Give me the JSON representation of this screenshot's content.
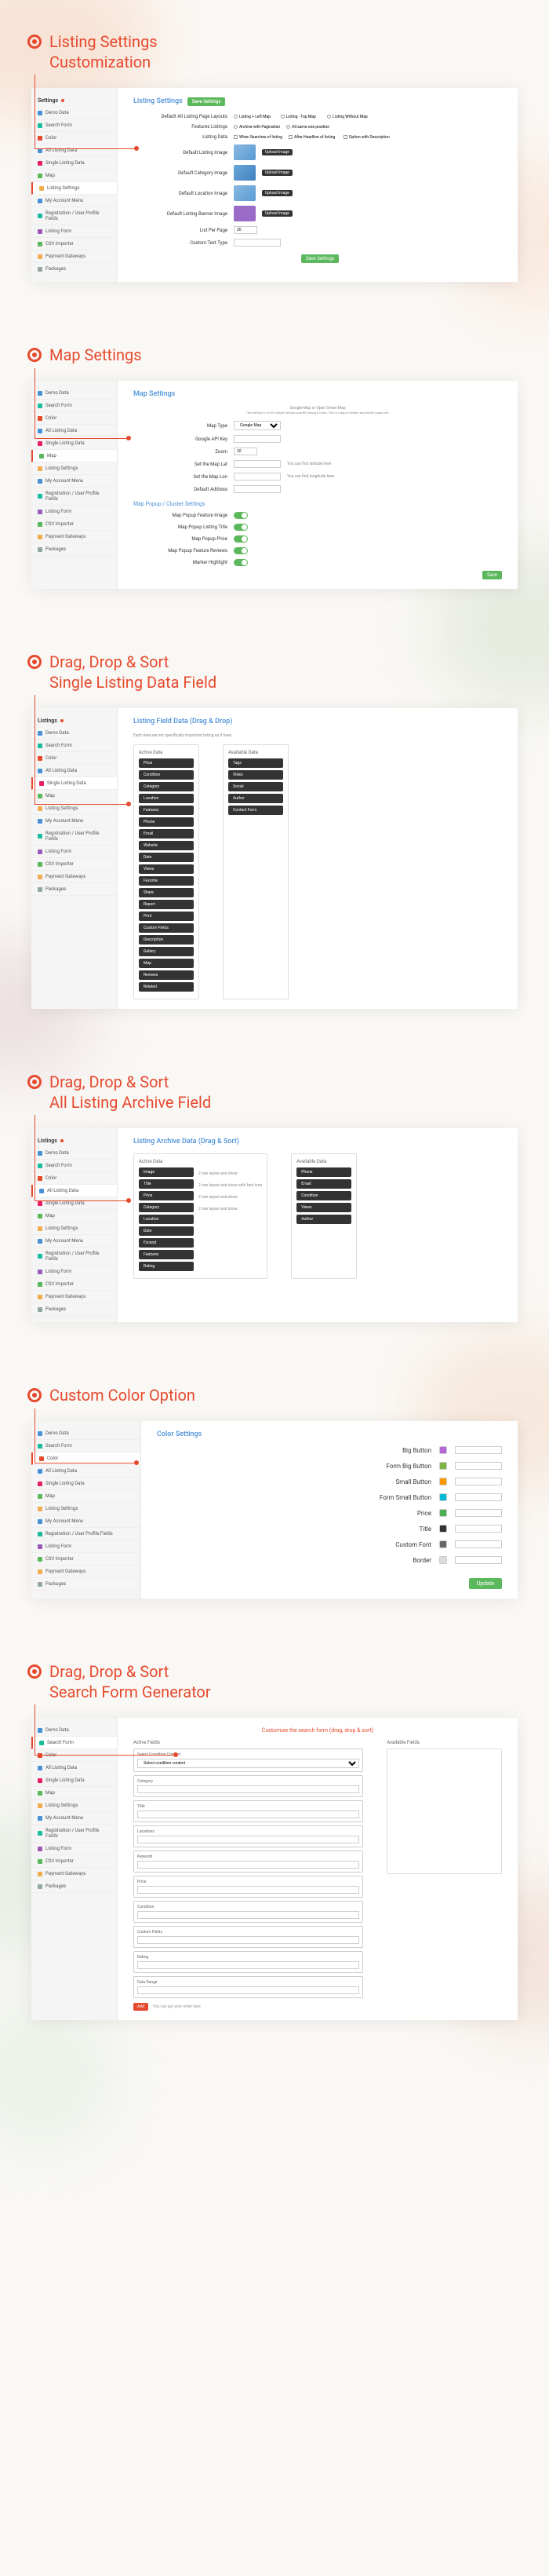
{
  "sections": [
    {
      "title": "Listing Settings\nCustomization"
    },
    {
      "title": "Map Settings"
    },
    {
      "title": "Drag, Drop & Sort\nSingle Listing Data Field"
    },
    {
      "title": "Drag, Drop & Sort\nAll Listing Archive Field"
    },
    {
      "title": "Custom Color Option"
    },
    {
      "title": "Drag, Drop & Sort\nSearch Form Generator"
    }
  ],
  "sidebar1": {
    "title": "Settings",
    "items": [
      "Demo Data",
      "Search Form",
      "Color",
      "All Listing Data",
      "Single Listing Data",
      "Map",
      "Listing Settings",
      "My Account Menu",
      "Registration / User Profile Fields",
      "Listing Form",
      "CSV Importer",
      "Payment Gateways",
      "Packages"
    ]
  },
  "panel1": {
    "title": "Listing Settings",
    "save": "Save Settings",
    "rows": {
      "layouts": "Default All Listing Page Layouts",
      "position": "Features Listings",
      "data": "Listing Data",
      "listing_img": "Default Listing Image",
      "category_img": "Default Category Image",
      "location_img": "Default Location Image",
      "banner_img": "Default Listing Banner Image",
      "per_page": "List Per Page",
      "text_type": "Custom Text Type"
    },
    "radios": [
      "Listing + Left Map",
      "Listing - Top Map",
      "Listing Without Map",
      "Archive with Pagination",
      "All same one position",
      "When Searches of listing",
      "After Headline of listing",
      "Option with Description"
    ],
    "input_val": "20",
    "upload": "Upload Image"
  },
  "sidebar2": {
    "items": [
      "Demo Data",
      "Search Form",
      "Color",
      "All Listing Data",
      "Single Listing Data",
      "Map",
      "Listing Settings",
      "My Account Menu",
      "Registration / User Profile Fields",
      "Listing Form",
      "CSV Importer",
      "Payment Gateways",
      "Packages"
    ]
  },
  "panel2": {
    "title": "Map Settings",
    "note": "Google Map or Open Street Map",
    "note2": "This setting is not for single listings specific listing & more. This is map on header and footer pages etc.",
    "labels": {
      "type": "Map Type",
      "key": "Google API Key",
      "zoom": "Zoom",
      "def_lat": "Set the Map Lat",
      "def_lon": "Set the Map Lon",
      "def_address": "Default Address",
      "section": "Map Popup / Cluster Settings",
      "pop_img": "Map Popup Feature Image",
      "pop_title": "Map Popup Listing Title",
      "pop_price": "Map Popup Price",
      "pop_rating": "Map Popup Feature Reviews",
      "marker": "Marker Highlight"
    },
    "type_opts": [
      "Google Map"
    ],
    "zoom_val": "10",
    "lat_hint": "You can find latitude here",
    "lon_hint": "You can find longitude here",
    "save": "Save"
  },
  "sidebar3": {
    "title": "Listings",
    "items": [
      "Demo Data",
      "Search Form",
      "Color",
      "All Listing Data",
      "Single Listing Data",
      "Map",
      "Listing Settings",
      "My Account Menu",
      "Registration / User Profile Fields",
      "Listing Form",
      "CSV Importer",
      "Payment Gateways",
      "Packages"
    ]
  },
  "panel3": {
    "title": "Listing Field Data (Drag & Drop)",
    "note": "Each data are not specifically important listing as it have",
    "col1": "Active Data",
    "col2": "Available Data",
    "active": [
      "Price",
      "Condition",
      "Category",
      "Location",
      "Features",
      "Phone",
      "Email",
      "Website",
      "Date",
      "Views",
      "Favorite",
      "Share",
      "Report",
      "Print",
      "Custom Fields",
      "Description",
      "Gallery",
      "Map",
      "Reviews",
      "Related"
    ],
    "avail": [
      "Tags",
      "Video",
      "Social",
      "Author",
      "Contact Form"
    ]
  },
  "sidebar4": {
    "title": "Listings",
    "items": [
      "Demo Data",
      "Search Form",
      "Color",
      "All Listing Data",
      "Single Listing Data",
      "Map",
      "Listing Settings",
      "My Account Menu",
      "Registration / User Profile Fields",
      "Listing Form",
      "CSV Importer",
      "Payment Gateways",
      "Packages"
    ]
  },
  "panel4": {
    "title": "Listing Archive Data (Drag & Sort)",
    "col1": "Active Data",
    "col2": "Available Data",
    "active": [
      "Image",
      "Title",
      "Price",
      "Category",
      "Location",
      "Date",
      "Excerpt",
      "Features",
      "Rating"
    ],
    "avail": [
      "Phone",
      "Email",
      "Condition",
      "Views",
      "Author"
    ],
    "hints": [
      "2 row layout and show",
      "2 row layout and show with font icon",
      "2 row layout and show",
      "2 row layout and show"
    ]
  },
  "sidebar5": {
    "items": [
      "Demo Data",
      "Search Form",
      "Color",
      "All Listing Data",
      "Single Listing Data",
      "Map",
      "Listing Settings",
      "My Account Menu",
      "Registration / User Profile Fields",
      "Listing Form",
      "CSV Importer",
      "Payment Gateways",
      "Packages"
    ]
  },
  "panel5": {
    "title": "Color Settings",
    "colors": [
      {
        "label": "Big Button",
        "c": "#b565d8"
      },
      {
        "label": "Form Big Button",
        "c": "#7cb342"
      },
      {
        "label": "Small Button",
        "c": "#ff9800"
      },
      {
        "label": "Form Small Button",
        "c": "#00bcd4"
      },
      {
        "label": "Price",
        "c": "#4caf50"
      },
      {
        "label": "Title",
        "c": "#333333"
      },
      {
        "label": "Custom Font",
        "c": "#666666"
      },
      {
        "label": "Border",
        "c": "#dddddd"
      }
    ],
    "save": "Update"
  },
  "sidebar6": {
    "items": [
      "Demo Data",
      "Search Form",
      "Color",
      "All Listing Data",
      "Single Listing Data",
      "Map",
      "Listing Settings",
      "My Account Menu",
      "Registration / User Profile Fields",
      "Listing Form",
      "CSV Importer",
      "Payment Gateways",
      "Packages"
    ]
  },
  "panel6": {
    "title": "Customize the search form (drag, drop & sort)",
    "col1": "Active Fields",
    "col2": "Available Fields",
    "condition": "Select Condition Content",
    "cond_opt": "Select condition content",
    "fields": [
      "Category",
      "Title",
      "Locations",
      "Keyword",
      "Price",
      "Condition",
      "Custom Fields",
      "Rating",
      "Date Range"
    ],
    "add": "Add",
    "note": "You can put your order here"
  }
}
